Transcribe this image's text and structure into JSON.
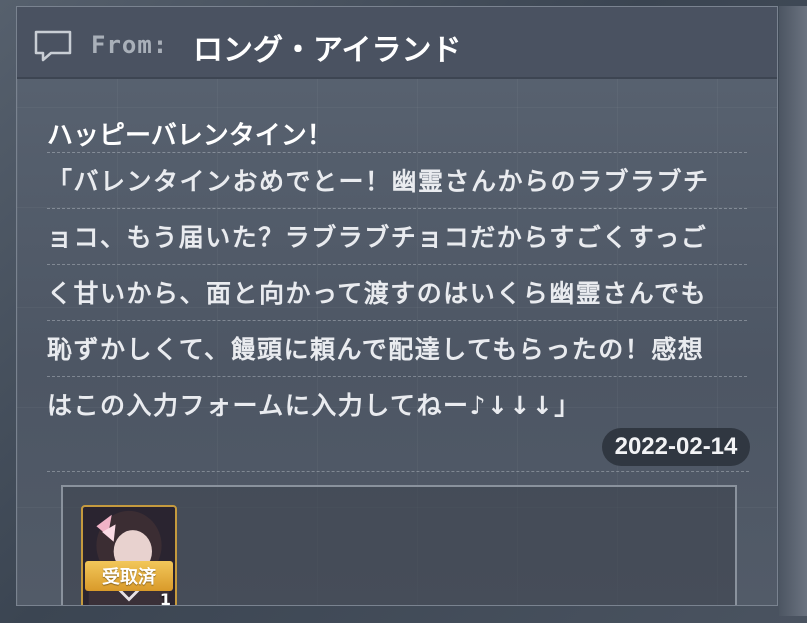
{
  "header": {
    "icon": "chat-bubble-icon",
    "from_prefix": "From:",
    "from_name": "ロング・アイランド"
  },
  "message": {
    "title": "ハッピーバレンタイン！",
    "lines": [
      "「バレンタインおめでとー！幽霊さんからのラブラブチ",
      "ョコ、もう届いた？ラブラブチョコだからすごくすっご",
      "く甘いから、面と向かって渡すのはいくら幽霊さんでも",
      "恥ずかしくて、饅頭に頼んで配達してもらったの！感想",
      "はこの入力フォームに入力してねー♪↓↓↓」"
    ],
    "date": "2022-02-14"
  },
  "reward": {
    "status_label": "受取済",
    "count": "1"
  }
}
